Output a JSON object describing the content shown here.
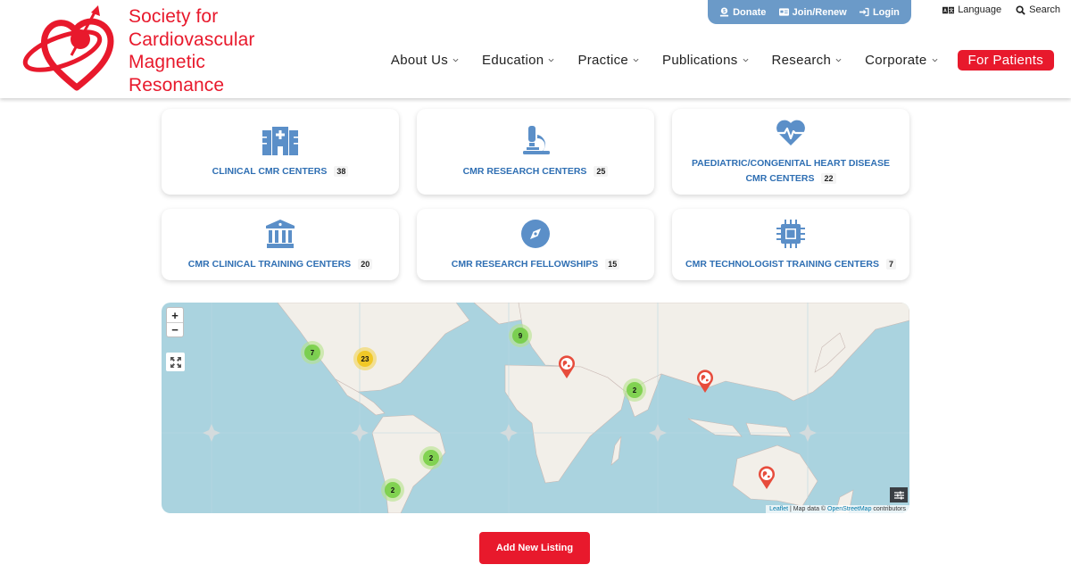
{
  "brand": {
    "name_lines": [
      "Society for",
      "Cardiovascular",
      "Magnetic",
      "Resonance"
    ],
    "primary_color": "#e8192c",
    "accent_color": "#6b9ac8",
    "link_color": "#2f6fb3"
  },
  "utility": {
    "donate": "Donate",
    "join": "Join/Renew",
    "login": "Login",
    "language": "Language",
    "search": "Search"
  },
  "nav": {
    "items": [
      {
        "label": "About Us"
      },
      {
        "label": "Education"
      },
      {
        "label": "Practice"
      },
      {
        "label": "Publications"
      },
      {
        "label": "Research"
      },
      {
        "label": "Corporate"
      }
    ],
    "cta": "For Patients"
  },
  "cards": [
    {
      "icon": "hospital-icon",
      "label": "CLINICAL CMR CENTERS",
      "count": "38"
    },
    {
      "icon": "microscope-icon",
      "label": "CMR RESEARCH CENTERS",
      "count": "25"
    },
    {
      "icon": "heart-pulse-icon",
      "label_line1": "PAEDIATRIC/CONGENITAL HEART DISEASE",
      "label_line2": "CMR CENTERS",
      "count": "22"
    },
    {
      "icon": "landmark-icon",
      "label": "CMR CLINICAL TRAINING CENTERS",
      "count": "20"
    },
    {
      "icon": "compass-icon",
      "label": "CMR RESEARCH FELLOWSHIPS",
      "count": "15"
    },
    {
      "icon": "microchip-icon",
      "label": "CMR TECHNOLOGIST TRAINING CENTERS",
      "count": "7"
    }
  ],
  "map": {
    "zoom_in": "+",
    "zoom_out": "−",
    "clusters": [
      {
        "region": "US West",
        "count": "7",
        "size": "small"
      },
      {
        "region": "US East",
        "count": "23",
        "size": "medium"
      },
      {
        "region": "Europe",
        "count": "9",
        "size": "small"
      },
      {
        "region": "India",
        "count": "2",
        "size": "small"
      },
      {
        "region": "Brazil",
        "count": "2",
        "size": "small"
      },
      {
        "region": "Chile/Argentina",
        "count": "2",
        "size": "small"
      }
    ],
    "pins": [
      "Middle East",
      "East Asia",
      "Australia"
    ],
    "attribution": {
      "leaflet": "Leaflet",
      "sep": " | Map data © ",
      "osm": "OpenStreetMap",
      "suffix": " contributors"
    }
  },
  "add_listing": "Add New Listing"
}
